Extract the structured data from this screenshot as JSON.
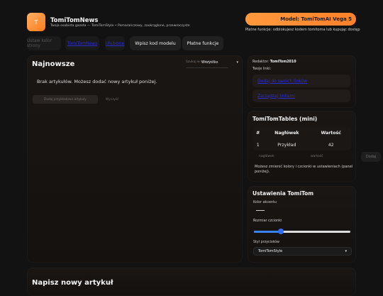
{
  "header": {
    "logo_letter": "T",
    "title": "TomiTomNews",
    "subtitle": "Twoja osobista gazeta — TomiTomStyle • Pomarańczowy, zaokrąglone, przewroczyste",
    "model_badge": "Model: TomiTomAI Vega 5",
    "paid_note": "Płatne funkcje: odblokujesz kodem tomitoma lub kupując dostęp"
  },
  "nav": {
    "items": [
      {
        "label": "Ustaw kolor strony"
      },
      {
        "label": "TomiTomNews"
      },
      {
        "label": "Ulubione"
      },
      {
        "label": "Wpisz kod modelu"
      },
      {
        "label": "Płatne funkcje"
      }
    ]
  },
  "news": {
    "title": "Najnowsze",
    "search_placeholder": "Szukaj w newsach...",
    "filter_value": "Wszystko",
    "empty_message": "Brak artykułów. Możesz dodać nowy artykuł poniżej.",
    "empty_button": "Dodaj przykładowe artykuły",
    "ghost_button": "Wyczyść"
  },
  "editor": {
    "label": "Redaktor:",
    "name": "TomiTom2010",
    "links_label": "Twoje linki:",
    "links": [
      "Dodaj do swoich linków",
      "Zarządzaj linkami"
    ]
  },
  "tables": {
    "title": "TomiTomTables (mini)",
    "headers": [
      "#",
      "Nagłówek",
      "Wartość"
    ],
    "rows": [
      {
        "num": "1",
        "title": "Przykład",
        "value": "42"
      }
    ],
    "placeholder_header": "nagłówek",
    "placeholder_value": "wartość",
    "add_button": "Dodaj",
    "note": "Możesz zmienić kolory i czcionki w ustawieniach (panel poniżej)."
  },
  "settings": {
    "title": "Ustawienia TomiTom",
    "accent_label": "Kolor akcentu",
    "font_size_label": "Rozmiar czcionki",
    "font_size_value": 0.28,
    "style_label": "Styl przycisków",
    "style_value": "TomiTomStyle"
  },
  "compose": {
    "title": "Napisz nowy artykuł"
  },
  "colors": {
    "accent": "#ff8a2a",
    "link": "#2b2bd8",
    "slider": "#3b82f6",
    "background": "#121212"
  }
}
